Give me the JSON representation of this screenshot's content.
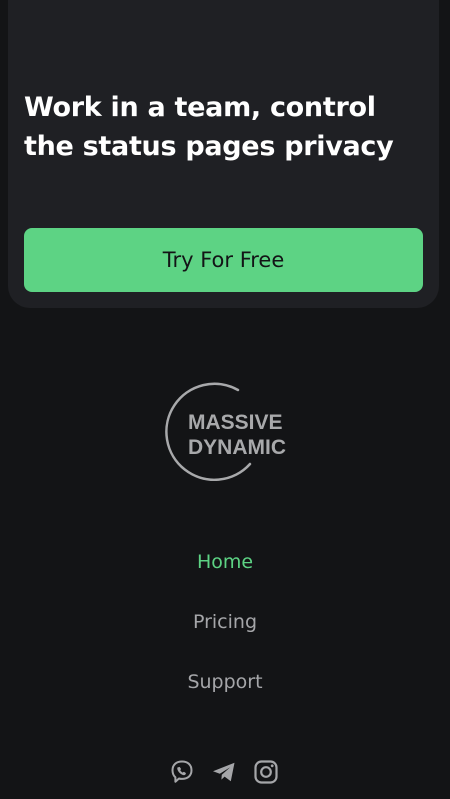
{
  "promo": {
    "title": "Work in a team, control the status pages privacy",
    "cta_label": "Try For Free"
  },
  "logo": {
    "line1": "MASSIVE",
    "line2": "DYNAMIC"
  },
  "nav": [
    {
      "label": "Home",
      "active": true
    },
    {
      "label": "Pricing",
      "active": false
    },
    {
      "label": "Support",
      "active": false
    }
  ],
  "socials": [
    "viber-icon",
    "telegram-icon",
    "instagram-icon"
  ],
  "colors": {
    "accent": "#5dd384",
    "card_bg": "#1f2024",
    "page_bg": "#131416",
    "muted_text": "#a5a6a9"
  }
}
